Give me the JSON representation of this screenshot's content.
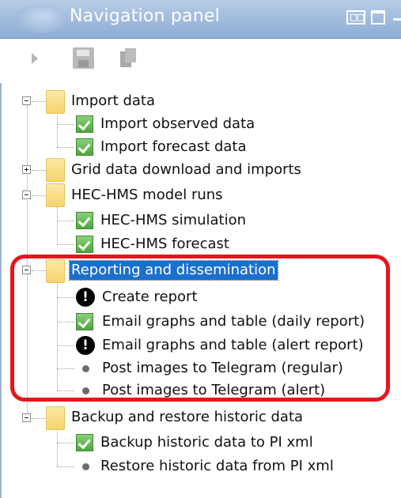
{
  "window": {
    "title": "Navigation panel"
  },
  "toolbar": {
    "run_icon": "play-icon",
    "save_icon": "save-icon",
    "save_all_icon": "save-all-icon"
  },
  "tree": {
    "groups": [
      {
        "label": "Import data",
        "expanded": true,
        "children": [
          {
            "label": "Import observed data",
            "status": "ok"
          },
          {
            "label": "Import forecast data",
            "status": "ok"
          }
        ]
      },
      {
        "label": "Grid data download and imports",
        "expanded": false,
        "children": []
      },
      {
        "label": "HEC-HMS model runs",
        "expanded": true,
        "children": [
          {
            "label": "HEC-HMS simulation",
            "status": "ok"
          },
          {
            "label": "HEC-HMS forecast",
            "status": "ok"
          }
        ]
      },
      {
        "label": "Reporting and dissemination",
        "expanded": true,
        "selected": true,
        "children": [
          {
            "label": "Create report",
            "status": "error"
          },
          {
            "label": "Email graphs and table (daily report)",
            "status": "ok"
          },
          {
            "label": "Email graphs and table (alert report)",
            "status": "error"
          },
          {
            "label": "Post images to Telegram (regular)",
            "status": "none"
          },
          {
            "label": "Post images to Telegram (alert)",
            "status": "none"
          }
        ]
      },
      {
        "label": "Backup and restore historic data",
        "expanded": true,
        "children": [
          {
            "label": "Backup historic data to PI xml",
            "status": "ok"
          },
          {
            "label": "Restore historic data from PI xml",
            "status": "none"
          }
        ]
      }
    ]
  },
  "colors": {
    "selection": "#1a6fcf",
    "highlight_box": "#e8141c",
    "titlebar": "#9fbadc"
  }
}
